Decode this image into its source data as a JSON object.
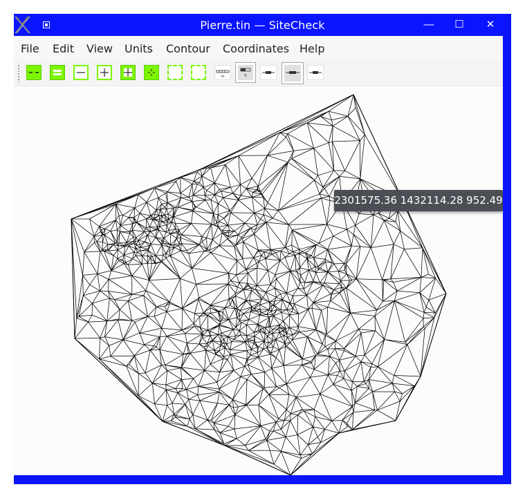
{
  "window": {
    "title": "Pierre.tin — SiteCheck",
    "accent_color": "#0a14ff"
  },
  "titlebar_buttons": {
    "minimize": "—",
    "maximize": "☐",
    "close": "✕"
  },
  "menu": {
    "file": "File",
    "edit": "Edit",
    "view": "View",
    "units": "Units",
    "contour": "Contour",
    "coordinates": "Coordinates",
    "help": "Help"
  },
  "toolbar": {
    "buttons": [
      {
        "icon": "dashed-line-icon",
        "style": "green-solid"
      },
      {
        "icon": "double-line-icon",
        "style": "green-solid"
      },
      {
        "icon": "zoom-out-icon",
        "style": "green-outline"
      },
      {
        "icon": "zoom-in-icon",
        "style": "green-outline"
      },
      {
        "icon": "grid-icon",
        "style": "green-solid"
      },
      {
        "icon": "crosshair-icon",
        "style": "green-solid"
      },
      {
        "icon": "dashed-box-icon",
        "style": "green-dash"
      },
      {
        "icon": "dashed-box-icon",
        "style": "green-dash"
      },
      {
        "icon": "scale-bar-icon",
        "style": "white"
      },
      {
        "icon": "elevation-bar-icon",
        "style": "pressed"
      },
      {
        "icon": "line-bar-icon",
        "style": "white"
      },
      {
        "icon": "line-bar-icon",
        "style": "pressed"
      },
      {
        "icon": "line-bar-icon",
        "style": "white"
      }
    ],
    "accent_green": "#7cf500"
  },
  "tooltip": {
    "coordinates": "2301575.36 1432114.28 952.49"
  }
}
